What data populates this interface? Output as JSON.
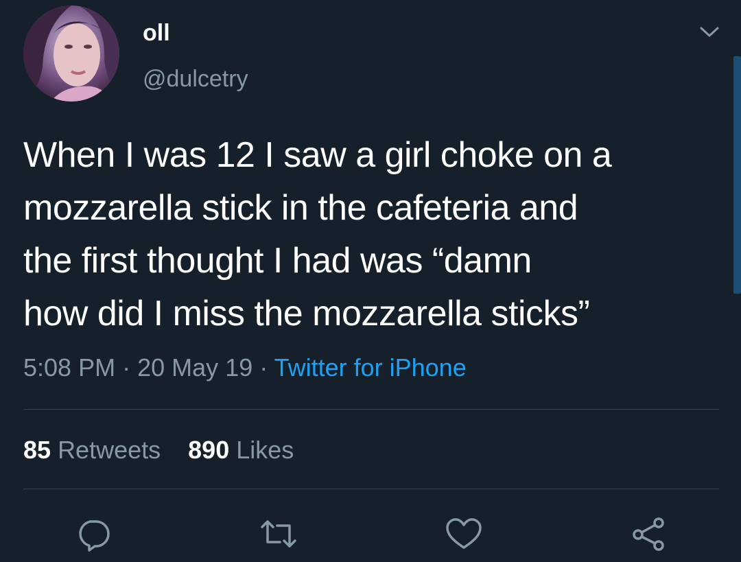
{
  "author": {
    "display_name": "oll",
    "handle": "@dulcetry",
    "avatar_icon": "profile-photo"
  },
  "tweet": {
    "text": "When I was 12 I saw a girl choke on a\nmozzarella stick in the cafeteria and\nthe first thought I had was “damn\nhow did I miss the mozzarella sticks”",
    "time": "5:08 PM",
    "separator": "·",
    "date": "20 May 19",
    "source": "Twitter for iPhone"
  },
  "stats": {
    "retweets_count": "85",
    "retweets_label": "Retweets",
    "likes_count": "890",
    "likes_label": "Likes"
  },
  "actions": {
    "reply_icon": "reply-icon",
    "retweet_icon": "retweet-icon",
    "like_icon": "heart-icon",
    "share_icon": "share-icon",
    "menu_icon": "chevron-down-icon"
  },
  "colors": {
    "background": "#15202b",
    "text": "#ffffff",
    "secondary": "#8899a6",
    "accent": "#1da1f2",
    "divider": "#38444d"
  }
}
